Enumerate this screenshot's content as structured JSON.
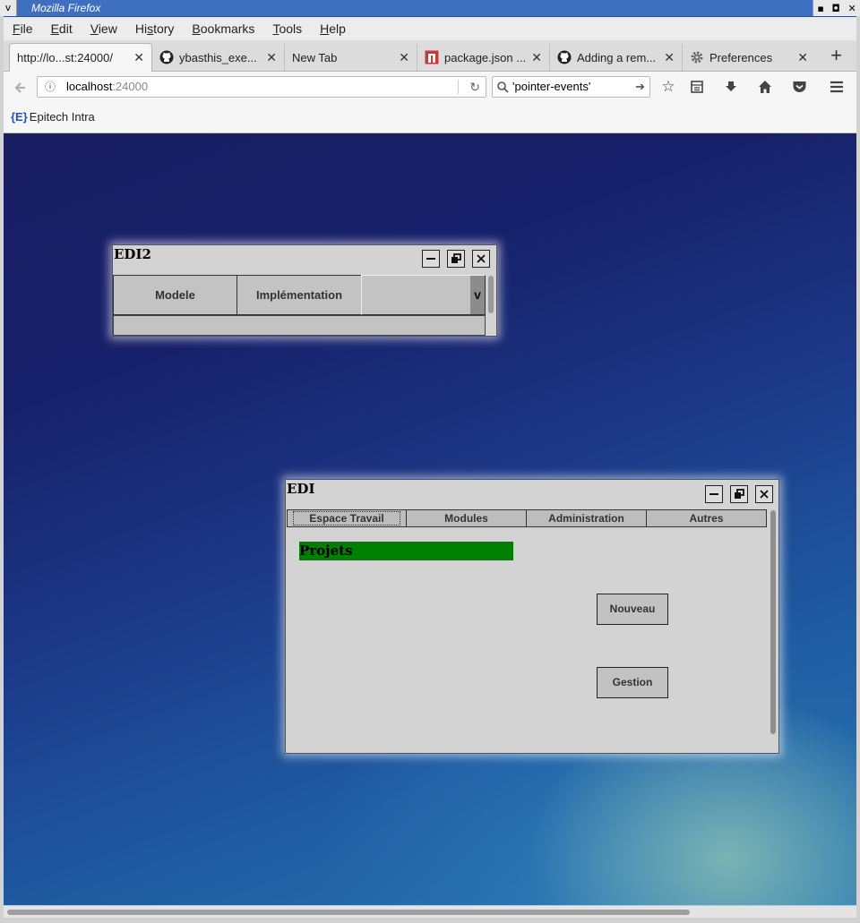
{
  "window": {
    "title": "Mozilla Firefox",
    "sysmenu_glyph": "v",
    "controls": {
      "minimize": "▪",
      "maximize": "◘",
      "close": "✕"
    }
  },
  "menubar": {
    "items": [
      {
        "label": "File",
        "accel": "F",
        "rest": "ile"
      },
      {
        "label": "Edit",
        "accel": "E",
        "rest": "dit"
      },
      {
        "label": "View",
        "accel": "V",
        "rest": "iew"
      },
      {
        "label": "History",
        "pre": "Hi",
        "accel": "s",
        "rest": "tory"
      },
      {
        "label": "Bookmarks",
        "accel": "B",
        "rest": "ookmarks"
      },
      {
        "label": "Tools",
        "accel": "T",
        "rest": "ools"
      },
      {
        "label": "Help",
        "accel": "H",
        "rest": "elp"
      }
    ]
  },
  "tabs": [
    {
      "title": "http://lo...st:24000/",
      "icon": "none",
      "active": true
    },
    {
      "title": "ybasthis_exe...",
      "icon": "github-icon"
    },
    {
      "title": "New Tab",
      "icon": "none"
    },
    {
      "title": "package.json ...",
      "icon": "npm-icon"
    },
    {
      "title": "Adding a rem...",
      "icon": "github-icon"
    },
    {
      "title": "Preferences",
      "icon": "gear-icon"
    }
  ],
  "tab_close_glyph": "✕",
  "newtab_glyph": "+",
  "navbar": {
    "url_host": "localhost",
    "url_port": ":24000",
    "search_value": "'pointer-events'",
    "search_placeholder": "Search"
  },
  "bookmarks": [
    {
      "label": "Epitech Intra",
      "icon_text": "{E}"
    }
  ],
  "edi2": {
    "title": "EDI2",
    "tabs": [
      "Modele",
      "Implémentation"
    ],
    "dropdown_arrow": "v"
  },
  "edi": {
    "title": "EDI",
    "tabs": [
      "Espace Travail",
      "Modules",
      "Administration",
      "Autres"
    ],
    "active_tab": "Espace Travail",
    "section_label": "Projets",
    "buttons": {
      "new": "Nouveau",
      "manage": "Gestion"
    }
  },
  "colors": {
    "titlebar": "#3f6fc0",
    "projets_bg": "#008000",
    "panel_bg": "#d3d3d3"
  },
  "scrollbar": {
    "horizontal_position": 0.0
  }
}
